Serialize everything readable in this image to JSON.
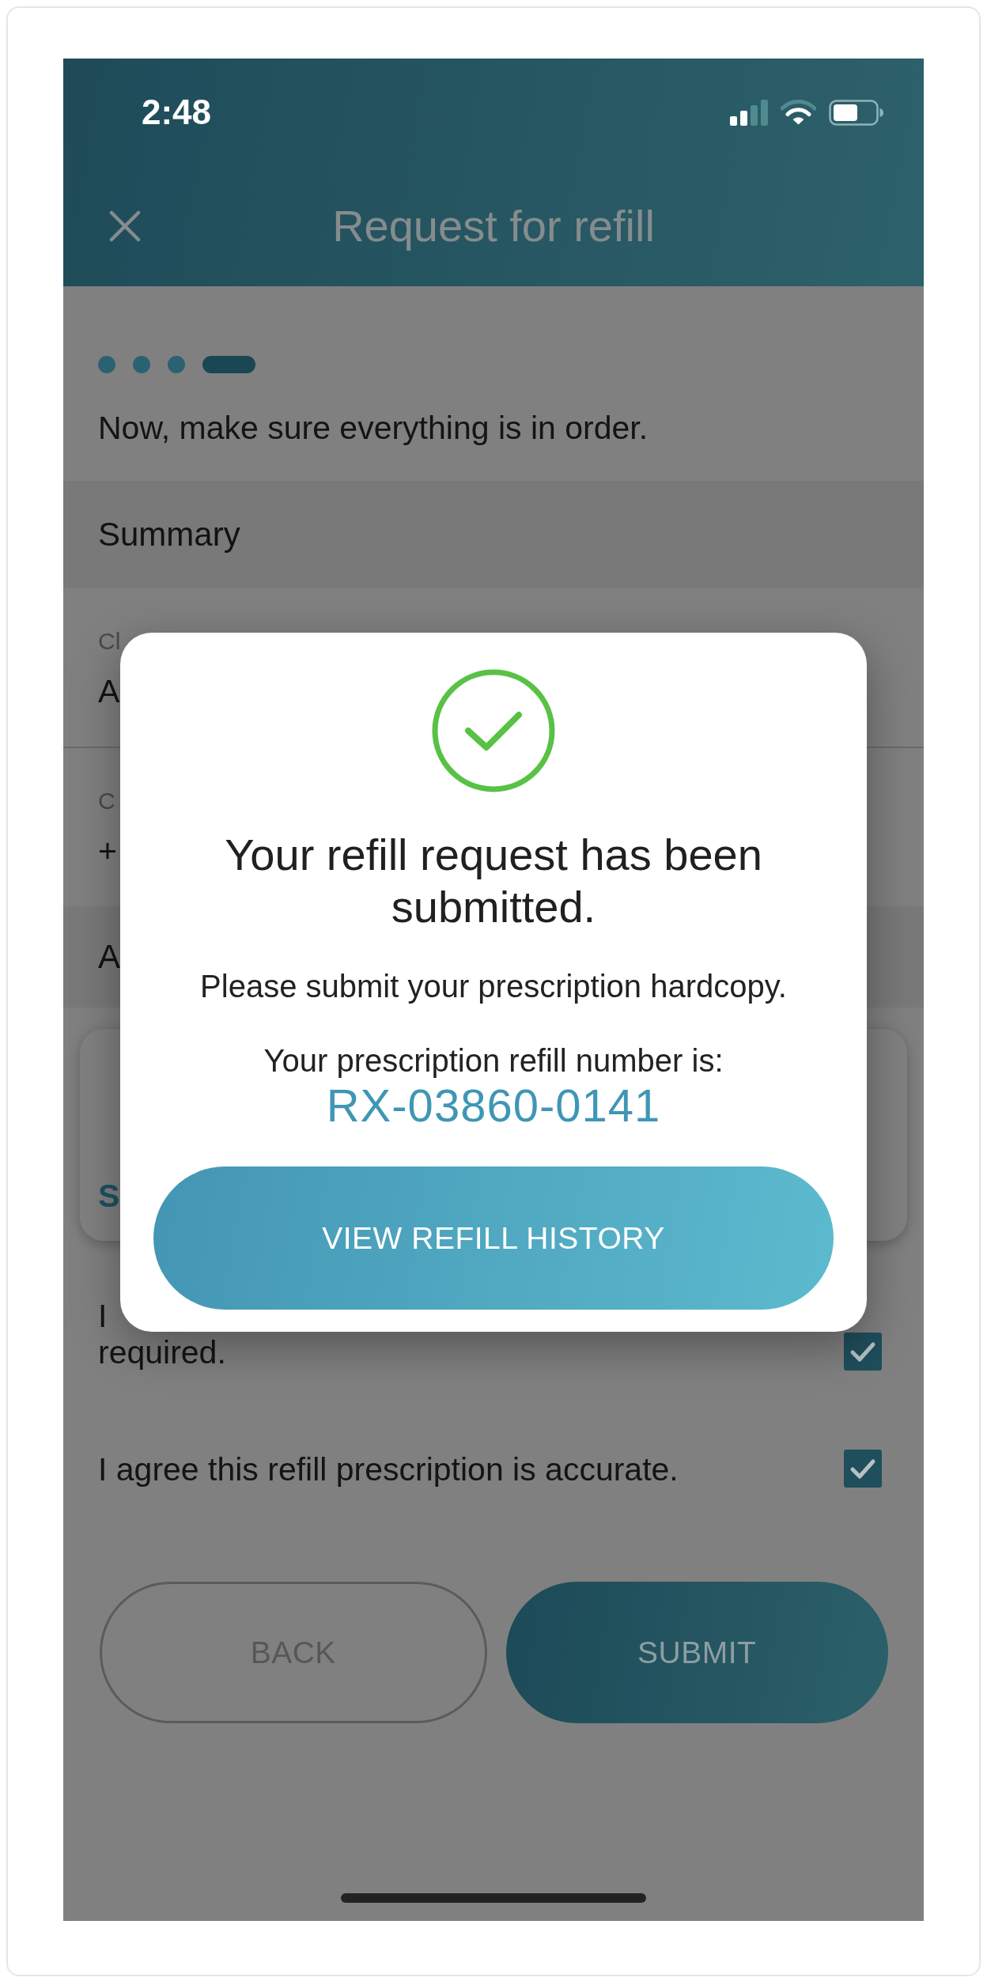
{
  "status_bar": {
    "time": "2:48"
  },
  "header": {
    "title": "Request for refill"
  },
  "steps": [
    {
      "selected": false
    },
    {
      "selected": false
    },
    {
      "selected": false
    },
    {
      "selected": true
    }
  ],
  "intro": "Now, make sure everything is in order.",
  "summary": {
    "heading": "Summary",
    "fields": [
      {
        "label": "Cl",
        "value": "A"
      },
      {
        "label": "C",
        "value": "+"
      }
    ]
  },
  "section": {
    "heading": "A"
  },
  "card": {
    "link": "S"
  },
  "agreements": [
    {
      "lines": [
        "I",
        "required."
      ],
      "checked": true
    },
    {
      "lines": [
        "I agree this refill prescription is accurate."
      ],
      "checked": true
    }
  ],
  "buttons": [
    {
      "label": "BACK",
      "kind": "outline"
    },
    {
      "label": "SUBMIT",
      "kind": "filled"
    }
  ],
  "dialog": {
    "title": "Your refill request has been submitted.",
    "message": "Please submit your prescription hardcopy.",
    "number_label": "Your prescription refill number is:",
    "number": "RX-03860-0141",
    "button": "VIEW REFILL HISTORY"
  }
}
